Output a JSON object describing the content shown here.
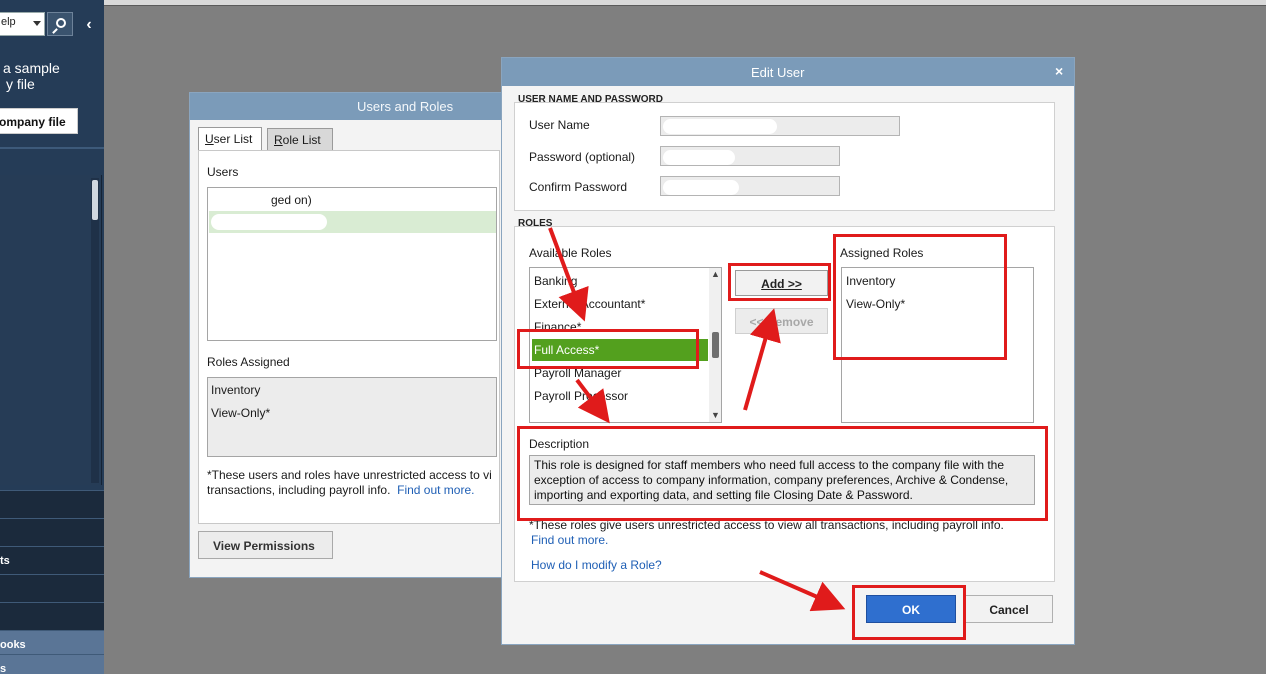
{
  "sidebar": {
    "help_select_value": "elp",
    "promo_line1": "a sample",
    "promo_line2": "y file",
    "open_button_label": "ompany file",
    "rows": [
      "",
      "ts",
      "",
      "",
      "ooks",
      "s"
    ]
  },
  "users_and_roles": {
    "title": "Users and Roles",
    "tabs": [
      {
        "key": "U",
        "label": "ser List"
      },
      {
        "key": "R",
        "label": "ole List"
      }
    ],
    "users_label": "Users",
    "users": [
      {
        "text": "ged on)"
      },
      {
        "text": ""
      }
    ],
    "roles_assigned_label": "Roles Assigned",
    "roles_assigned": [
      "Inventory",
      "View-Only*"
    ],
    "note_text": "*These users and roles have unrestricted access to vi",
    "note_text2": "transactions, including payroll info.",
    "find_out_more": "Find out more.",
    "view_permissions_label": "View Permissions"
  },
  "edit_user": {
    "title": "Edit User",
    "close_glyph": "×",
    "credentials_section": "USER NAME AND PASSWORD",
    "user_name_label": "User Name",
    "password_label": "Password (optional)",
    "confirm_password_label": "Confirm Password",
    "roles_section": "ROLES",
    "available_roles_label": "Available Roles",
    "available_roles": [
      "Banking",
      "External Accountant*",
      "Finance*",
      "Full Access*",
      "Payroll Manager",
      "Payroll Processor"
    ],
    "selected_role": "Full Access*",
    "add_button": "Add >>",
    "remove_button": "<< Remove",
    "assigned_roles_label": "Assigned Roles",
    "assigned_roles": [
      "Inventory",
      "View-Only*"
    ],
    "description_label": "Description",
    "description_text": "This role is designed for staff members who need full access to the company file with the exception of access to company information, company preferences, Archive & Condense, importing and exporting data, and setting file Closing Date & Password.",
    "note_text": "*These roles give users unrestricted access to view all transactions, including payroll info.",
    "find_out_more": "Find out more.",
    "how_modify_link": "How do I modify a Role?",
    "ok_button": "OK",
    "cancel_button": "Cancel"
  },
  "colors": {
    "annotation_red": "#e01b1b",
    "selected_green": "#53a01e",
    "title_bar": "#7b9bb9",
    "ok_blue": "#2f6fcf",
    "sidebar_navy": "#253c57"
  }
}
